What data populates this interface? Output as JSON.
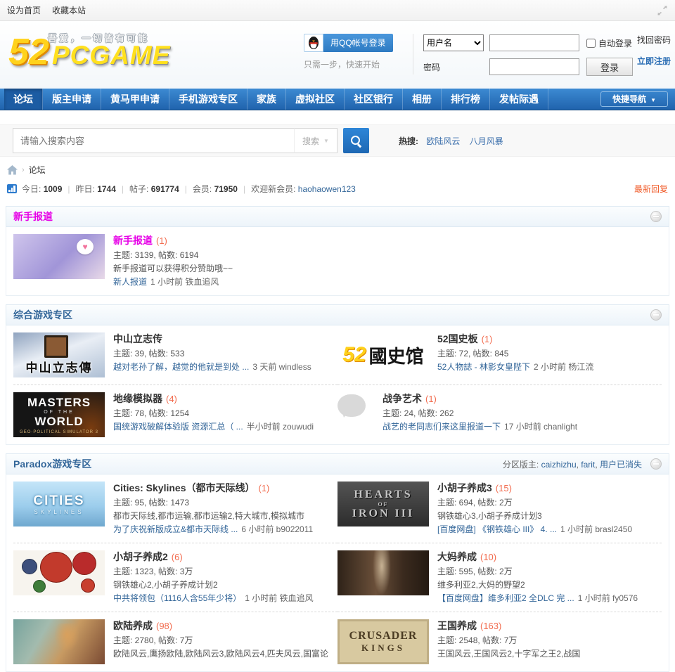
{
  "topbar": {
    "links": [
      "设为首页",
      "收藏本站"
    ]
  },
  "header": {
    "logo_52": "52",
    "logo_word": "PCGAME",
    "slogan": "吾爱，一切皆有可能"
  },
  "login": {
    "qq_button": "用QQ帐号登录",
    "qq_hint": "只需一步，快速开始",
    "username_option": "用户名",
    "password_label": "密码",
    "auto_login": "自动登录",
    "login_button": "登录",
    "find_password": "找回密码",
    "register": "立即注册"
  },
  "nav": {
    "items": [
      {
        "label": "论坛",
        "active": true
      },
      {
        "label": "版主申请",
        "active": false
      },
      {
        "label": "黄马甲申请",
        "active": false
      },
      {
        "label": "手机游戏专区",
        "active": false
      },
      {
        "label": "家族",
        "active": false
      },
      {
        "label": "虚拟社区",
        "active": false
      },
      {
        "label": "社区银行",
        "active": false
      },
      {
        "label": "相册",
        "active": false
      },
      {
        "label": "排行榜",
        "active": false
      },
      {
        "label": "发帖际遇",
        "active": false
      }
    ],
    "quick_nav": "快捷导航"
  },
  "search": {
    "placeholder": "请输入搜索内容",
    "dropdown_label": "搜索",
    "hot_label": "热搜:",
    "hot_links": [
      "欧陆风云",
      "八月风暴"
    ]
  },
  "breadcrumb": {
    "current": "论坛"
  },
  "stats": {
    "today_label": "今日:",
    "today": "1009",
    "yesterday_label": "昨日:",
    "yesterday": "1744",
    "posts_label": "帖子:",
    "posts": "691774",
    "members_label": "会员:",
    "members": "71950",
    "welcome_label": "欢迎新会员:",
    "newest": "haohaowen123",
    "latest": "最新回复"
  },
  "colors": {
    "link_blue": "#336699",
    "count_orange": "#f26c4f",
    "nav_blue": "#2b7acd",
    "newbie_magenta": "#e600e6",
    "latest_orange": "#f05a28"
  },
  "sections": [
    {
      "title": "新手报道",
      "title_color": "#e600e6",
      "forums": [
        {
          "name": "新手报道",
          "color": "#e600e6",
          "count": "(1)",
          "stats": "主题: 3139, 帖数: 6194",
          "desc": "新手报道可以获得积分赞助哦~~",
          "last_link": "新人报道",
          "last_meta": "1 小时前 铁血追风",
          "img": {
            "cls": "anime",
            "lines": []
          }
        }
      ]
    },
    {
      "title": "综合游戏专区",
      "title_color": "#336699",
      "forums": [
        {
          "name": "中山立志传",
          "count": "",
          "stats": "主题: 39, 帖数: 533",
          "last_link": "越对老孙了解，越觉的他就是到处 ...",
          "last_meta": "3 天前 windless",
          "img": {
            "cls": "zhongshan",
            "lines": [
              "中山立志傳"
            ]
          }
        },
        {
          "name": "52国史板",
          "count": "(1)",
          "stats": "主题: 72, 帖数: 845",
          "last_link": "52人物誌 - 林影女皇陛下",
          "last_meta": "2 小时前 杨江流",
          "img": {
            "cls": "gsg",
            "lines": [
              "52",
              "國史馆"
            ]
          }
        },
        {
          "name": "地缘模拟器",
          "count": "(4)",
          "stats": "主题: 78, 帖数: 1254",
          "last_link": "国统游戏破解体验版 资源汇总（ ...",
          "last_meta": "半小时前 zouwudi",
          "img": {
            "cls": "masters",
            "lines": [
              "MASTERS",
              "OF THE",
              "WORLD",
              "GEO-POLITICAL SIMULATOR 3"
            ]
          }
        },
        {
          "name": "战争艺术",
          "count": "(1)",
          "stats": "主题: 24, 帖数: 262",
          "last_link": "战艺的老同志们来这里报道一下",
          "last_meta": "17 小时前 chanlight",
          "img": {
            "cls": "bubble",
            "lines": []
          }
        }
      ]
    },
    {
      "title": "Paradox游戏专区",
      "title_color": "#336699",
      "moderators": {
        "label": "分区版主:",
        "names": [
          "caizhizhu",
          "farit",
          "用户已消失"
        ]
      },
      "forums": [
        {
          "name": "Cities: Skylines（都市天际线）",
          "count": "(1)",
          "stats": "主题: 95, 帖数: 1473",
          "desc": "都市天际线,都市运输,都市运输2,特大城市,模拟城市",
          "last_link": "为了庆祝新版成立&都市天际线 ...",
          "last_meta": "6 小时前 b9022011",
          "img": {
            "cls": "cities",
            "lines": [
              "CITIES",
              "SKYLINES"
            ]
          }
        },
        {
          "name": "小胡子养成3",
          "count": "(15)",
          "stats": "主题: 694, 帖数: 2万",
          "desc": "钢铁雄心3,小胡子养成计划3",
          "last_link": "[百度网盘] 《钢铁雄心 III》 4. ...",
          "last_meta": "1 小时前 brasl2450",
          "img": {
            "cls": "hoi3",
            "lines": [
              "HEARTS",
              "OF",
              "IRON III"
            ]
          }
        },
        {
          "name": "小胡子养成2",
          "count": "(6)",
          "stats": "主题: 1323, 帖数: 3万",
          "desc": "钢铁雄心2,小胡子养成计划2",
          "last_link": "中共将领包（1116人含55年少将）",
          "last_meta": "1 小时前 铁血追风",
          "img": {
            "cls": "balls",
            "lines": []
          }
        },
        {
          "name": "大妈养成",
          "count": "(10)",
          "stats": "主题: 595, 帖数: 2万",
          "desc": "维多利亚2,大妈的野望2",
          "last_link": "【百度网盘】维多利亚2 全DLC 完 ...",
          "last_meta": "1 小时前 fy0576",
          "img": {
            "cls": "victoria",
            "lines": []
          }
        },
        {
          "name": "欧陆养成",
          "count": "(98)",
          "stats": "主题: 2780, 帖数: 7万",
          "desc": "欧陆风云,鹰扬欧陆,欧陆风云3,欧陆风云4,匹夫风云,国富论",
          "last_link": "",
          "last_meta": "",
          "img": {
            "cls": "eu",
            "lines": []
          }
        },
        {
          "name": "王国养成",
          "count": "(163)",
          "stats": "主题: 2548, 帖数: 7万",
          "desc": "王国风云,王国风云2,十字军之王2,战国",
          "last_link": "",
          "last_meta": "",
          "img": {
            "cls": "ck",
            "lines": [
              "CRUSADER",
              "KINGS"
            ]
          }
        }
      ]
    }
  ]
}
